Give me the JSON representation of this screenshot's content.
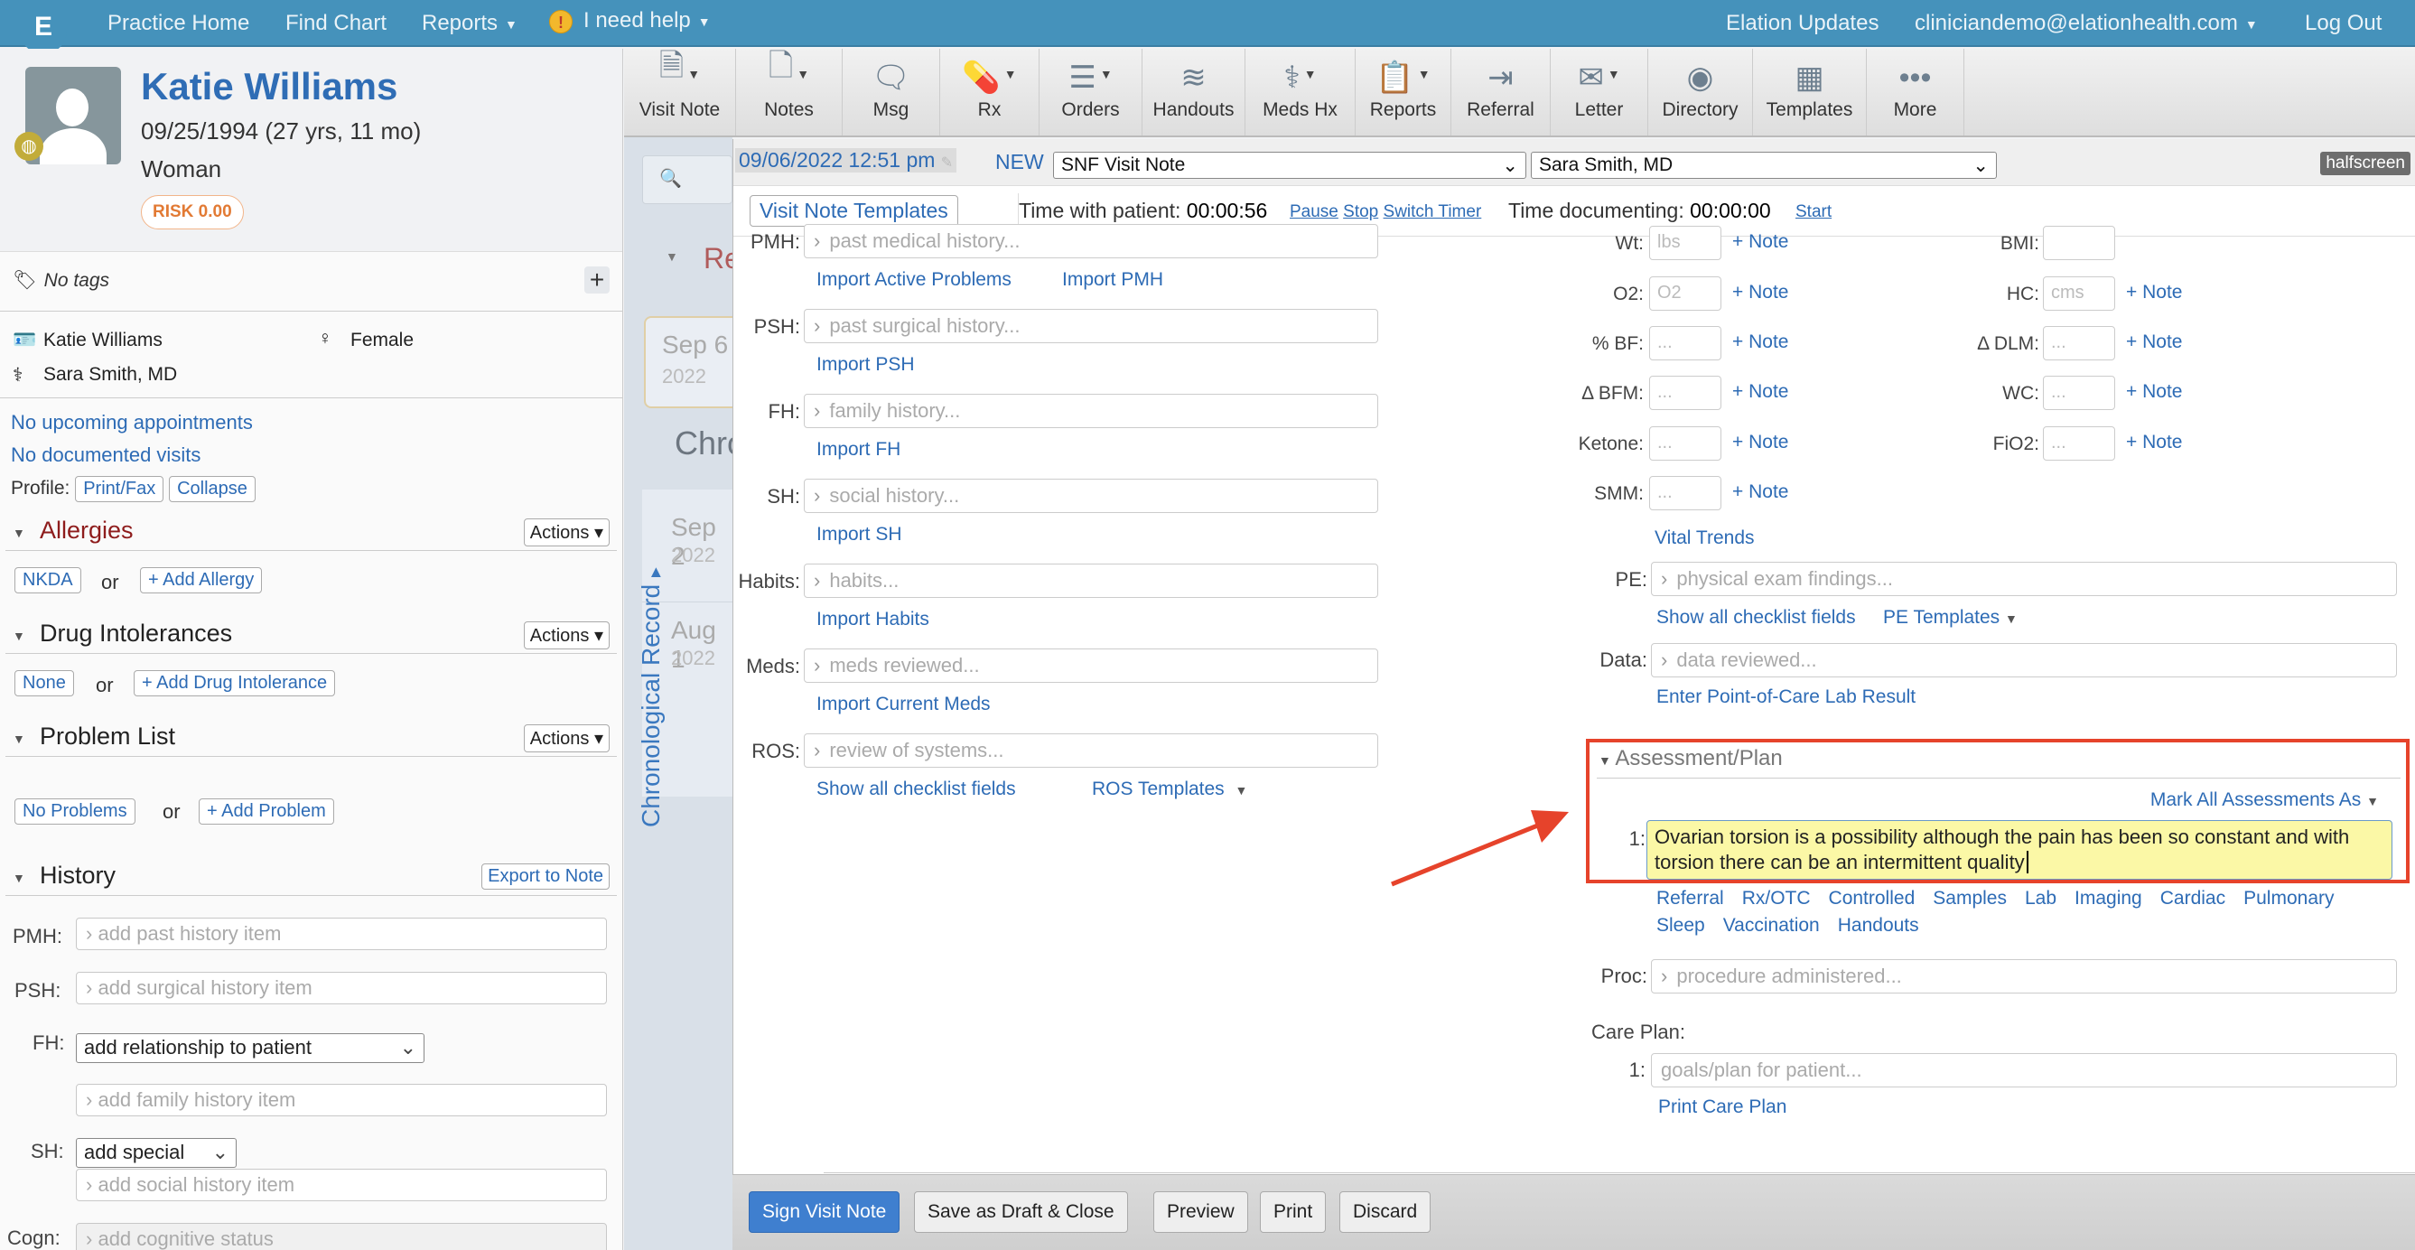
{
  "topnav": {
    "logo": "E",
    "practice_home": "Practice Home",
    "find_chart": "Find Chart",
    "reports": "Reports",
    "help_icon": "!",
    "help": "I need help",
    "updates": "Elation Updates",
    "user": "cliniciandemo@elationhealth.com",
    "logout": "Log Out"
  },
  "patient": {
    "name": "Katie Williams",
    "dob": "09/25/1994 (27 yrs, 11 mo)",
    "gender_identity": "Woman",
    "risk": "RISK 0.00",
    "tags": "No tags",
    "legal_name": "Katie Williams",
    "sex": "Female",
    "provider": "Sara Smith, MD",
    "appointments": "No upcoming appointments",
    "visits": "No documented visits",
    "profile_label": "Profile:",
    "print_fax": "Print/Fax",
    "collapse": "Collapse"
  },
  "sections": {
    "allergies": {
      "title": "Allergies",
      "actions": "Actions",
      "none_btn": "NKDA",
      "or": "or",
      "add_btn": "+ Add Allergy"
    },
    "drug_intolerances": {
      "title": "Drug Intolerances",
      "actions": "Actions",
      "none_btn": "None",
      "or": "or",
      "add_btn": "+ Add Drug Intolerance"
    },
    "problem_list": {
      "title": "Problem List",
      "actions": "Actions",
      "none_btn": "No Problems",
      "or": "or",
      "add_btn": "+ Add Problem"
    },
    "history": {
      "title": "History",
      "export": "Export to Note",
      "pmh_label": "PMH:",
      "pmh_placeholder": "add past history item",
      "psh_label": "PSH:",
      "psh_placeholder": "add surgical history item",
      "fh_label": "FH:",
      "fh_select": "add relationship to patient",
      "fh_placeholder": "add family history item",
      "sh_label": "SH:",
      "sh_select": "add special",
      "sh_placeholder": "add social history item",
      "cogn_label": "Cogn:",
      "cogn_placeholder": "add cognitive status"
    }
  },
  "timeline": {
    "section_label": "Re",
    "entry1_date": "Sep 6",
    "entry1_year": "2022",
    "chrono_title": "Chro",
    "entry2_date": "Sep 2",
    "entry2_year": "2022",
    "entry3_date": "Aug 1",
    "entry3_year": "2022",
    "vertical_label": "Chronological Record"
  },
  "toolbar": [
    {
      "label": "Visit Note",
      "icon": "visit-note-icon",
      "glyph": "🗎",
      "dropdown": true
    },
    {
      "label": "Notes",
      "icon": "notes-icon",
      "glyph": "🗋",
      "dropdown": true
    },
    {
      "label": "Msg",
      "icon": "message-icon",
      "glyph": "🗨",
      "dropdown": false
    },
    {
      "label": "Rx",
      "icon": "pill-icon",
      "glyph": "💊",
      "dropdown": true
    },
    {
      "label": "Orders",
      "icon": "orders-icon",
      "glyph": "☰",
      "dropdown": true
    },
    {
      "label": "Handouts",
      "icon": "handouts-icon",
      "glyph": "≋",
      "dropdown": false
    },
    {
      "label": "Meds Hx",
      "icon": "meds-history-icon",
      "glyph": "⚕",
      "dropdown": true
    },
    {
      "label": "Reports",
      "icon": "reports-icon",
      "glyph": "📋",
      "dropdown": true
    },
    {
      "label": "Referral",
      "icon": "referral-icon",
      "glyph": "⇥",
      "dropdown": false
    },
    {
      "label": "Letter",
      "icon": "letter-icon",
      "glyph": "✉",
      "dropdown": true
    },
    {
      "label": "Directory",
      "icon": "directory-icon",
      "glyph": "◉",
      "dropdown": false
    },
    {
      "label": "Templates",
      "icon": "templates-icon",
      "glyph": "▦",
      "dropdown": false
    },
    {
      "label": "More",
      "icon": "more-icon",
      "glyph": "•••",
      "dropdown": false
    }
  ],
  "note": {
    "datetime": "09/06/2022 12:51 pm",
    "status": "NEW",
    "note_type": "SNF Visit Note",
    "provider": "Sara Smith, MD",
    "halfscreen": "halfscreen",
    "templates_btn": "Visit Note Templates",
    "time_with_patient_label": "Time with patient:",
    "time_with_patient": "00:00:56",
    "pause": "Pause",
    "stop": "Stop",
    "switch_timer": "Switch Timer",
    "time_documenting_label": "Time documenting:",
    "time_documenting": "00:00:00",
    "start": "Start",
    "left_fields": [
      {
        "label": "PMH:",
        "placeholder": "past medical history...",
        "links": [
          "Import Active Problems",
          "Import PMH"
        ]
      },
      {
        "label": "PSH:",
        "placeholder": "past surgical history...",
        "links": [
          "Import PSH"
        ]
      },
      {
        "label": "FH:",
        "placeholder": "family history...",
        "links": [
          "Import FH"
        ]
      },
      {
        "label": "SH:",
        "placeholder": "social history...",
        "links": [
          "Import SH"
        ]
      },
      {
        "label": "Habits:",
        "placeholder": "habits...",
        "links": [
          "Import Habits"
        ]
      },
      {
        "label": "Meds:",
        "placeholder": "meds reviewed...",
        "links": [
          "Import Current Meds"
        ]
      },
      {
        "label": "ROS:",
        "placeholder": "review of systems...",
        "links": [
          "Show all checklist fields",
          "ROS Templates"
        ]
      }
    ],
    "vitals": {
      "note_link": "+ Note",
      "left": [
        {
          "label": "Wt:",
          "placeholder": "lbs"
        },
        {
          "label": "O2:",
          "placeholder": "O2"
        },
        {
          "label": "% BF:",
          "placeholder": "..."
        },
        {
          "label": "Δ BFM:",
          "placeholder": "..."
        },
        {
          "label": "Ketone:",
          "placeholder": "..."
        },
        {
          "label": "SMM:",
          "placeholder": "..."
        }
      ],
      "right": [
        {
          "label": "BMI:",
          "placeholder": ""
        },
        {
          "label": "HC:",
          "placeholder": "cms"
        },
        {
          "label": "Δ DLM:",
          "placeholder": "..."
        },
        {
          "label": "WC:",
          "placeholder": "..."
        },
        {
          "label": "FiO2:",
          "placeholder": "..."
        }
      ],
      "trends": "Vital Trends"
    },
    "pe": {
      "label": "PE:",
      "placeholder": "physical exam findings...",
      "checklist": "Show all checklist fields",
      "templates": "PE Templates"
    },
    "data": {
      "label": "Data:",
      "placeholder": "data reviewed...",
      "poc": "Enter Point-of-Care Lab Result"
    },
    "assessment": {
      "title": "Assessment/Plan",
      "mark_all": "Mark All Assessments As",
      "item_num": "1:",
      "item_text": "Ovarian torsion is a possibility although the pain has been so constant and with torsion there can be an intermittent quality",
      "order_links": [
        "Referral",
        "Rx/OTC",
        "Controlled",
        "Samples",
        "Lab",
        "Imaging",
        "Cardiac",
        "Pulmonary",
        "Sleep",
        "Vaccination",
        "Handouts"
      ]
    },
    "proc": {
      "label": "Proc:",
      "placeholder": "procedure administered..."
    },
    "care_plan": {
      "label": "Care Plan:",
      "num": "1:",
      "placeholder": "goals/plan for patient...",
      "print": "Print Care Plan"
    }
  },
  "bottom": {
    "sign": "Sign Visit Note",
    "save_draft": "Save as Draft & Close",
    "preview": "Preview",
    "print": "Print",
    "discard": "Discard"
  },
  "annotation": {
    "color": "#e6432b"
  }
}
